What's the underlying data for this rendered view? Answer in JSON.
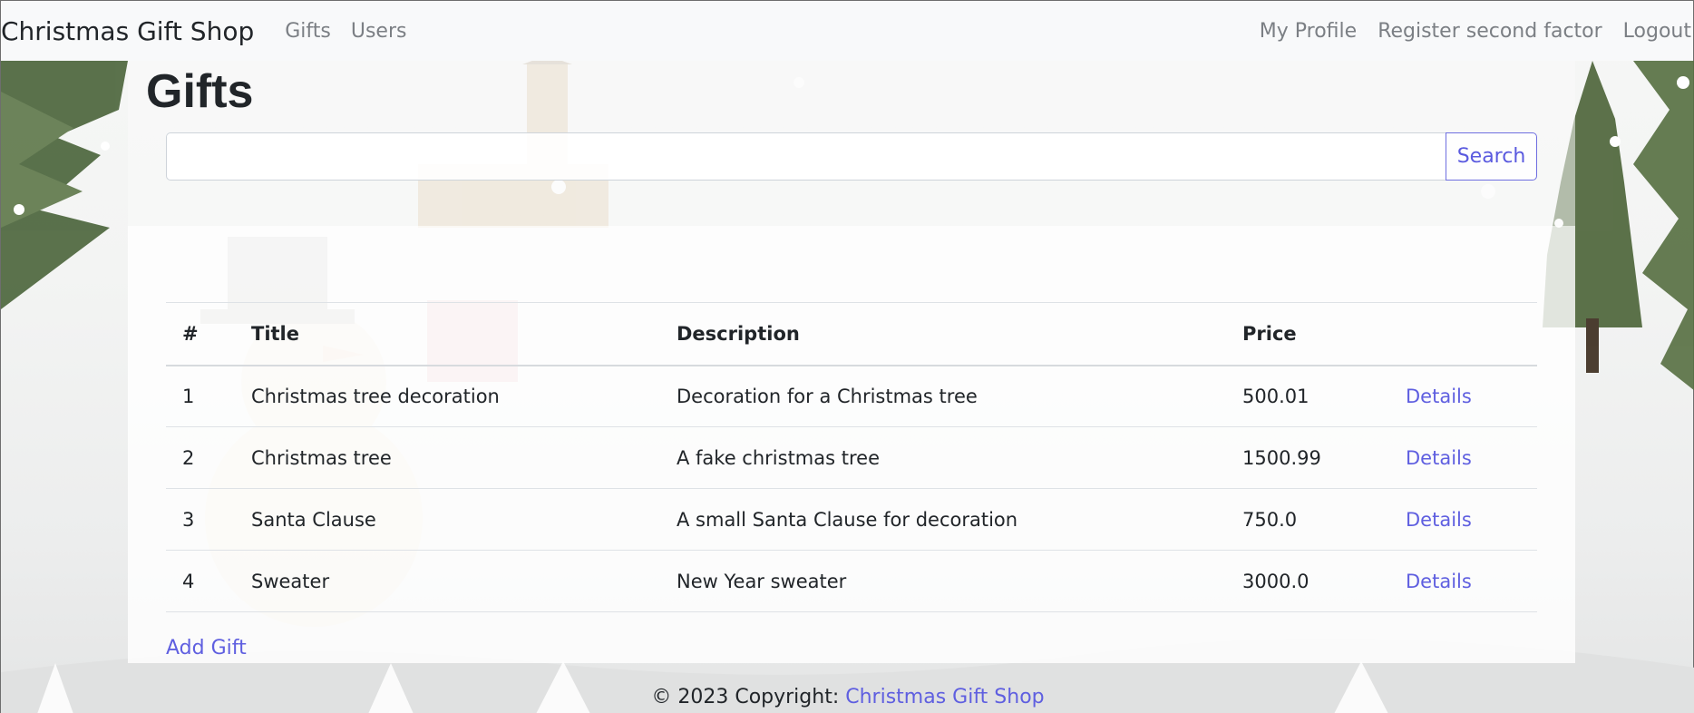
{
  "navbar": {
    "brand": "Christmas Gift Shop",
    "left_links": [
      "Gifts",
      "Users"
    ],
    "right_links": [
      "My Profile",
      "Register second factor",
      "Logout"
    ]
  },
  "main": {
    "title": "Gifts",
    "search": {
      "value": "",
      "placeholder": "",
      "button_label": "Search"
    },
    "table": {
      "headers": [
        "#",
        "Title",
        "Description",
        "Price",
        ""
      ],
      "rows": [
        {
          "num": "1",
          "title": "Christmas tree decoration",
          "description": "Decoration for a Christmas tree",
          "price": "500.01",
          "action": "Details"
        },
        {
          "num": "2",
          "title": "Christmas tree",
          "description": "A fake christmas tree",
          "price": "1500.99",
          "action": "Details"
        },
        {
          "num": "3",
          "title": "Santa Clause",
          "description": "A small Santa Clause for decoration",
          "price": "750.0",
          "action": "Details"
        },
        {
          "num": "4",
          "title": "Sweater",
          "description": "New Year sweater",
          "price": "3000.0",
          "action": "Details"
        }
      ]
    },
    "add_link": "Add Gift"
  },
  "footer": {
    "prefix": "© 2023 Copyright:",
    "link": "Christmas Gift Shop"
  },
  "colors": {
    "link": "#5f5fe0",
    "navbar_bg": "#f8f9fa",
    "nav_link": "#7b7f84"
  },
  "background_icons": [
    "pine-tree-icon",
    "snowman-icon",
    "house-icon",
    "snowflake-icon"
  ]
}
